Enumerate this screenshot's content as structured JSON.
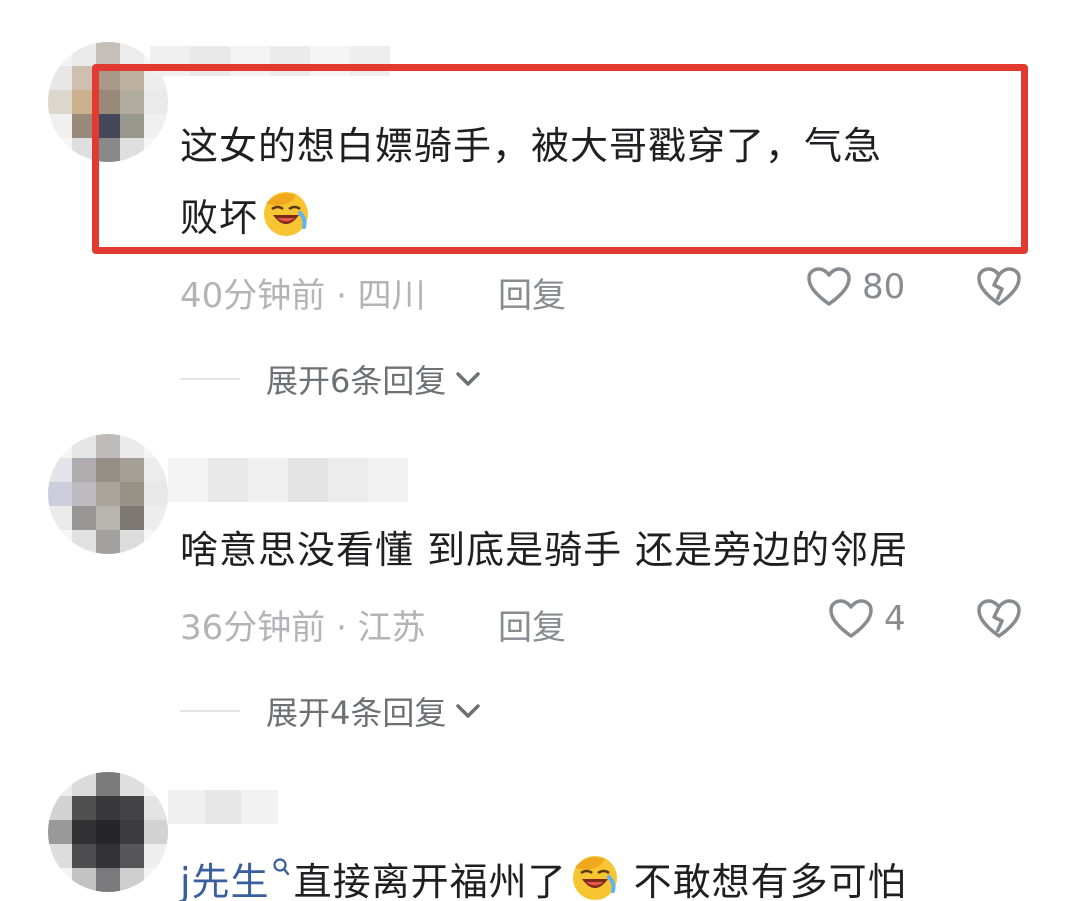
{
  "comments": [
    {
      "text_line1": "这女的想白嫖骑手，被大哥戳穿了，气急",
      "text_line2": "败坏",
      "meta": "40分钟前 · 四川",
      "reply": "回复",
      "likes": "80",
      "expand": "展开6条回复"
    },
    {
      "text_line1": "啥意思没看懂 到底是骑手 还是旁边的邻居",
      "meta": "36分钟前 · 江苏",
      "reply": "回复",
      "likes": "4",
      "expand": "展开4条回复"
    },
    {
      "mention": "j先生",
      "text_after_mention": "直接离开福州了",
      "text_tail": " 不敢想有多可怕"
    }
  ],
  "colors": {
    "highlight": "#e23a30",
    "mention": "#3a5f9e",
    "meta": "#b3b3b8"
  },
  "icons": [
    "heart-outline-icon",
    "broken-heart-icon",
    "chevron-down-icon",
    "facepalm-laugh-emoji",
    "search-icon"
  ]
}
